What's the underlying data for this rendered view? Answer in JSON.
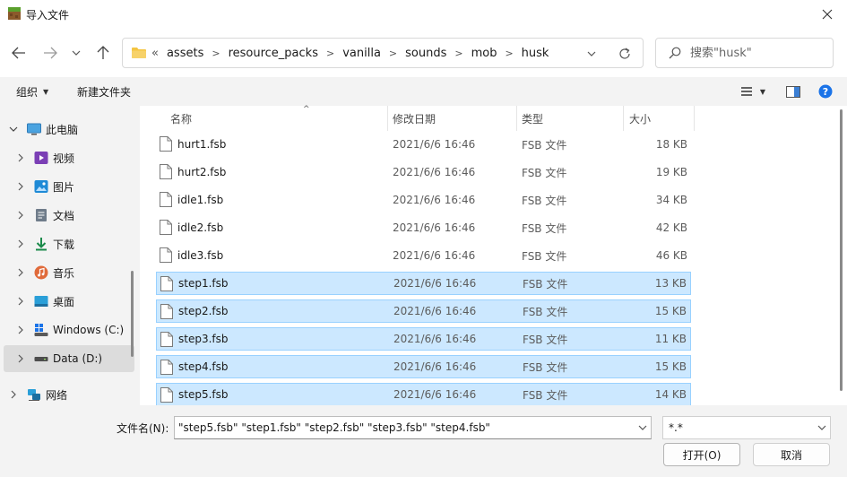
{
  "window": {
    "title": "导入文件"
  },
  "address": {
    "more": "«",
    "crumbs": [
      "assets",
      "resource_packs",
      "vanilla",
      "sounds",
      "mob",
      "husk"
    ]
  },
  "search": {
    "placeholder": "搜索\"husk\""
  },
  "toolbar": {
    "organize": "组织",
    "new_folder": "新建文件夹"
  },
  "sidebar": {
    "items": [
      {
        "label": "此电脑",
        "icon": "monitor-icon",
        "expanded": true
      },
      {
        "label": "视频",
        "icon": "video-icon"
      },
      {
        "label": "图片",
        "icon": "pictures-icon"
      },
      {
        "label": "文档",
        "icon": "document-icon"
      },
      {
        "label": "下载",
        "icon": "download-icon"
      },
      {
        "label": "音乐",
        "icon": "music-icon"
      },
      {
        "label": "桌面",
        "icon": "desktop-icon"
      },
      {
        "label": "Windows (C:)",
        "icon": "windows-drive-icon"
      },
      {
        "label": "Data (D:)",
        "icon": "drive-icon",
        "selected": true
      },
      {
        "label": "网络",
        "icon": "network-icon"
      }
    ]
  },
  "columns": {
    "name": "名称",
    "date": "修改日期",
    "type": "类型",
    "size": "大小"
  },
  "files": [
    {
      "name": "hurt1.fsb",
      "date": "2021/6/6 16:46",
      "type": "FSB 文件",
      "size": "18 KB",
      "selected": false
    },
    {
      "name": "hurt2.fsb",
      "date": "2021/6/6 16:46",
      "type": "FSB 文件",
      "size": "19 KB",
      "selected": false
    },
    {
      "name": "idle1.fsb",
      "date": "2021/6/6 16:46",
      "type": "FSB 文件",
      "size": "34 KB",
      "selected": false
    },
    {
      "name": "idle2.fsb",
      "date": "2021/6/6 16:46",
      "type": "FSB 文件",
      "size": "42 KB",
      "selected": false
    },
    {
      "name": "idle3.fsb",
      "date": "2021/6/6 16:46",
      "type": "FSB 文件",
      "size": "46 KB",
      "selected": false
    },
    {
      "name": "step1.fsb",
      "date": "2021/6/6 16:46",
      "type": "FSB 文件",
      "size": "13 KB",
      "selected": true
    },
    {
      "name": "step2.fsb",
      "date": "2021/6/6 16:46",
      "type": "FSB 文件",
      "size": "15 KB",
      "selected": true
    },
    {
      "name": "step3.fsb",
      "date": "2021/6/6 16:46",
      "type": "FSB 文件",
      "size": "11 KB",
      "selected": true
    },
    {
      "name": "step4.fsb",
      "date": "2021/6/6 16:46",
      "type": "FSB 文件",
      "size": "15 KB",
      "selected": true
    },
    {
      "name": "step5.fsb",
      "date": "2021/6/6 16:46",
      "type": "FSB 文件",
      "size": "14 KB",
      "selected": true
    }
  ],
  "bottom": {
    "filename_label": "文件名(N):",
    "filename_value": "\"step5.fsb\" \"step1.fsb\" \"step2.fsb\" \"step3.fsb\" \"step4.fsb\"",
    "filter_value": "*.*",
    "open_label": "打开(O)",
    "cancel_label": "取消"
  },
  "colors": {
    "selection_bg": "#cce8ff",
    "selection_border": "#99d1ff",
    "help": "#1a73e8",
    "folder": "#f4c542"
  }
}
